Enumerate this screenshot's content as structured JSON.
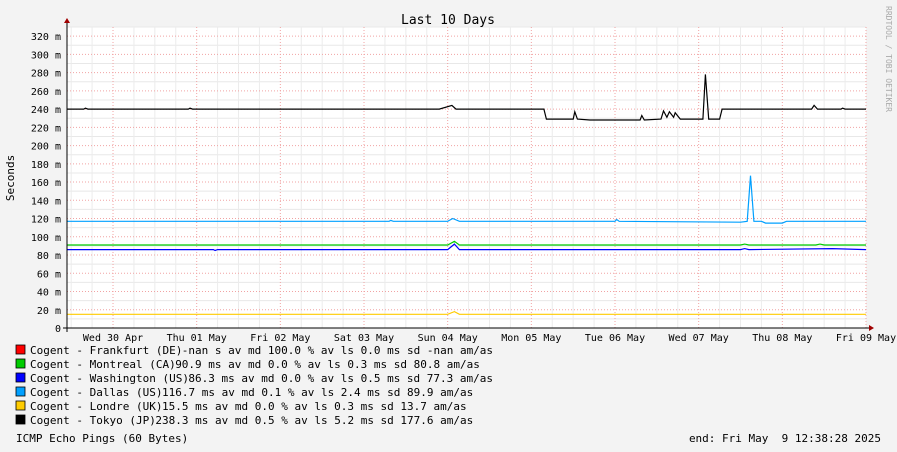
{
  "chart_data": {
    "type": "line",
    "title": "Last 10 Days",
    "ylabel": "Seconds",
    "xlabel": "",
    "watermark": "RRDTOOL / TOBI OETIKER",
    "ylim": [
      0,
      330
    ],
    "y_ticks": [
      {
        "value": 0,
        "label": "0"
      },
      {
        "value": 20,
        "label": "20 m"
      },
      {
        "value": 40,
        "label": "40 m"
      },
      {
        "value": 60,
        "label": "60 m"
      },
      {
        "value": 80,
        "label": "80 m"
      },
      {
        "value": 100,
        "label": "100 m"
      },
      {
        "value": 120,
        "label": "120 m"
      },
      {
        "value": 140,
        "label": "140 m"
      },
      {
        "value": 160,
        "label": "160 m"
      },
      {
        "value": 180,
        "label": "180 m"
      },
      {
        "value": 200,
        "label": "200 m"
      },
      {
        "value": 220,
        "label": "220 m"
      },
      {
        "value": 240,
        "label": "240 m"
      },
      {
        "value": 260,
        "label": "260 m"
      },
      {
        "value": 280,
        "label": "280 m"
      },
      {
        "value": 300,
        "label": "300 m"
      },
      {
        "value": 320,
        "label": "320 m"
      }
    ],
    "x_days": [
      "Wed 30 Apr",
      "Thu 01 May",
      "Fri 02 May",
      "Sat 03 May",
      "Sun 04 May",
      "Mon 05 May",
      "Tue 06 May",
      "Wed 07 May",
      "Thu 08 May",
      "Fri 09 May"
    ],
    "x_range_days": [
      -0.55,
      9.0
    ],
    "grid": true,
    "series": [
      {
        "name": "Cogent - Frankfurt (DE)",
        "color": "#ff0000",
        "stats": "   -nan  s av md    100.0 % av ls     0.0 ms sd    -nan   am/as",
        "points": []
      },
      {
        "name": "Cogent - Montreal (CA)",
        "color": "#00cc00",
        "stats": "  90.9 ms av md      0.0 % av ls     0.3 ms sd   80.8   am/as",
        "points": [
          [
            -0.55,
            91
          ],
          [
            4.0,
            91
          ],
          [
            4.08,
            95
          ],
          [
            4.14,
            91
          ],
          [
            7.5,
            91
          ],
          [
            7.55,
            92
          ],
          [
            7.6,
            91
          ],
          [
            8.4,
            91
          ],
          [
            8.45,
            92
          ],
          [
            8.5,
            91
          ],
          [
            9.0,
            91
          ]
        ]
      },
      {
        "name": "Cogent - Washington (US)",
        "color": "#0000ff",
        "stats": "   86.3 ms av md      0.0 % av ls     0.5 ms sd   77.3   am/as",
        "points": [
          [
            -0.55,
            86
          ],
          [
            1.2,
            86
          ],
          [
            1.22,
            85
          ],
          [
            1.25,
            86
          ],
          [
            4.0,
            86
          ],
          [
            4.08,
            92
          ],
          [
            4.14,
            86
          ],
          [
            7.5,
            86
          ],
          [
            7.55,
            87
          ],
          [
            7.6,
            86
          ],
          [
            8.6,
            87
          ],
          [
            9.0,
            86
          ]
        ]
      },
      {
        "name": "Cogent - Dallas (US)",
        "color": "#00a0ff",
        "stats": "  116.7 ms av md      0.1 % av ls     2.4 ms sd   89.9   am/as",
        "points": [
          [
            -0.55,
            117
          ],
          [
            3.3,
            117
          ],
          [
            3.32,
            118
          ],
          [
            3.35,
            117
          ],
          [
            4.0,
            117
          ],
          [
            4.06,
            120
          ],
          [
            4.14,
            117
          ],
          [
            6.0,
            117
          ],
          [
            6.02,
            119
          ],
          [
            6.05,
            117
          ],
          [
            7.5,
            116
          ],
          [
            7.58,
            117
          ],
          [
            7.62,
            167
          ],
          [
            7.66,
            117
          ],
          [
            7.75,
            117
          ],
          [
            7.8,
            115
          ],
          [
            8.0,
            115
          ],
          [
            8.05,
            117
          ],
          [
            9.0,
            117
          ]
        ]
      },
      {
        "name": "Cogent - Londre (UK)",
        "color": "#ffcc00",
        "stats": "   15.5 ms av md      0.0 % av ls     0.3 ms sd   13.7   am/as",
        "points": [
          [
            -0.55,
            15
          ],
          [
            4.0,
            15
          ],
          [
            4.08,
            18
          ],
          [
            4.14,
            15
          ],
          [
            9.0,
            15
          ]
        ]
      },
      {
        "name": "Cogent - Tokyo (JP)",
        "color": "#000000",
        "stats": "  238.3 ms av md      0.5 % av ls     5.2 ms sd  177.6   am/as",
        "points": [
          [
            -0.55,
            240
          ],
          [
            -0.35,
            240
          ],
          [
            -0.33,
            241
          ],
          [
            -0.3,
            240
          ],
          [
            0.9,
            240
          ],
          [
            0.92,
            241
          ],
          [
            0.95,
            240
          ],
          [
            3.9,
            240
          ],
          [
            4.05,
            244
          ],
          [
            4.1,
            240
          ],
          [
            5.15,
            240
          ],
          [
            5.18,
            229
          ],
          [
            5.5,
            229
          ],
          [
            5.52,
            237
          ],
          [
            5.55,
            229
          ],
          [
            5.7,
            228
          ],
          [
            6.3,
            228
          ],
          [
            6.32,
            233
          ],
          [
            6.35,
            228
          ],
          [
            6.55,
            229
          ],
          [
            6.58,
            238
          ],
          [
            6.62,
            231
          ],
          [
            6.65,
            237
          ],
          [
            6.7,
            231
          ],
          [
            6.72,
            236
          ],
          [
            6.78,
            229
          ],
          [
            7.05,
            229
          ],
          [
            7.08,
            278
          ],
          [
            7.12,
            229
          ],
          [
            7.25,
            229
          ],
          [
            7.28,
            240
          ],
          [
            8.35,
            240
          ],
          [
            8.38,
            244
          ],
          [
            8.42,
            240
          ],
          [
            8.7,
            240
          ],
          [
            8.72,
            241
          ],
          [
            8.75,
            240
          ],
          [
            9.0,
            240
          ]
        ]
      }
    ],
    "footer_left": "ICMP Echo Pings (60 Bytes)",
    "footer_right": "end: Fri May  9 12:38:28 2025"
  }
}
